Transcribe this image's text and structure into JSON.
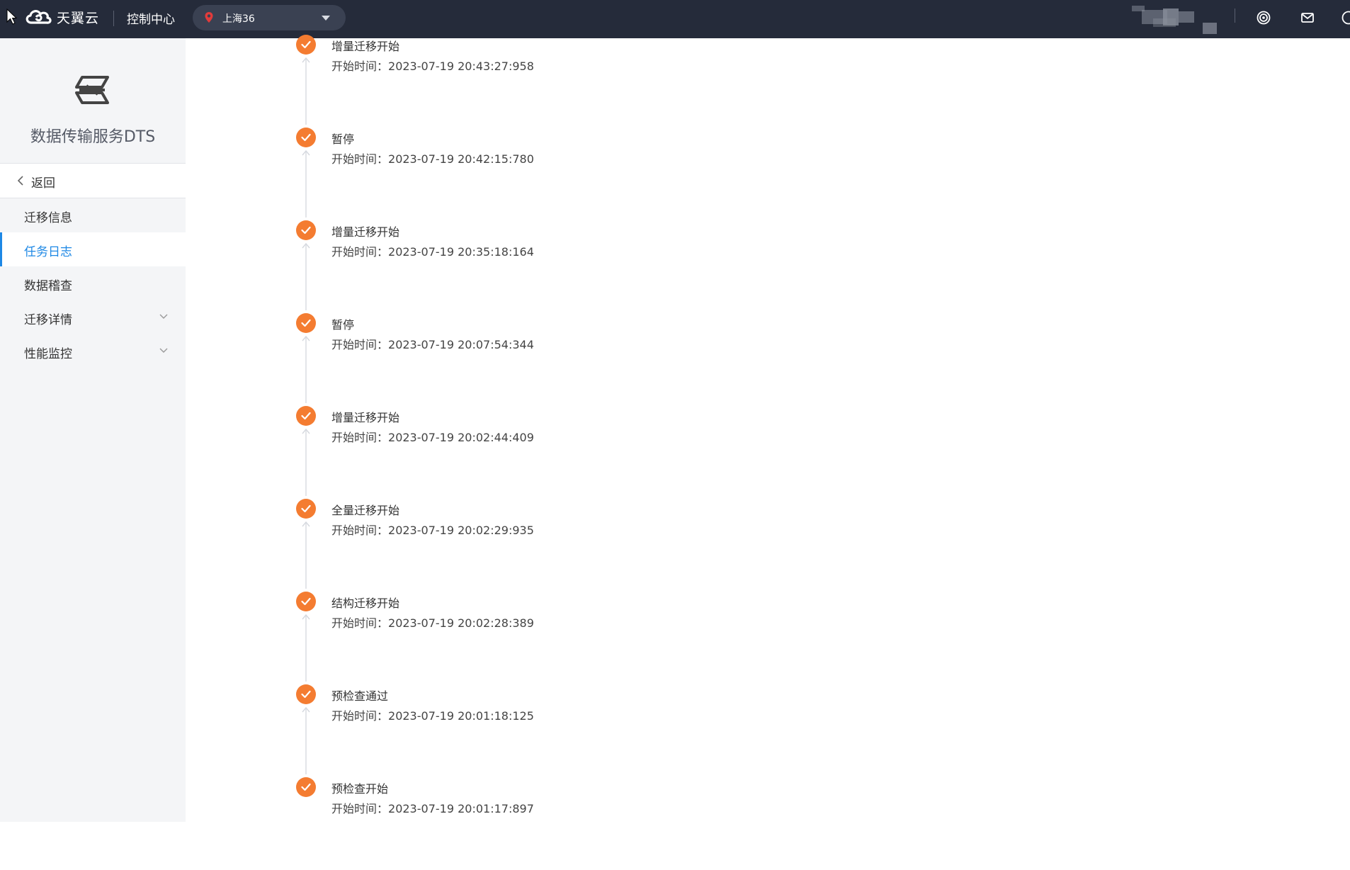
{
  "brand": {
    "logo_text": "天翼云",
    "console_label": "控制中心",
    "region_label": "上海36"
  },
  "colors": {
    "topbar": "#252b3a",
    "accent_blue": "#1e88e5",
    "timeline_orange": "#f47c31",
    "sidebar_bg": "#f4f5f7"
  },
  "sidebar": {
    "service_name": "数据传输服务DTS",
    "back_label": "返回",
    "items": [
      {
        "label": "迁移信息",
        "active": false,
        "expandable": false
      },
      {
        "label": "任务日志",
        "active": true,
        "expandable": false
      },
      {
        "label": "数据稽查",
        "active": false,
        "expandable": false
      },
      {
        "label": "迁移详情",
        "active": false,
        "expandable": true
      },
      {
        "label": "性能监控",
        "active": false,
        "expandable": true
      }
    ]
  },
  "timeline": {
    "time_prefix": "开始时间：",
    "events": [
      {
        "title": "增量迁移开始",
        "time": "2023-07-19 20:43:27:958"
      },
      {
        "title": "暂停",
        "time": "2023-07-19 20:42:15:780"
      },
      {
        "title": "增量迁移开始",
        "time": "2023-07-19 20:35:18:164"
      },
      {
        "title": "暂停",
        "time": "2023-07-19 20:07:54:344"
      },
      {
        "title": "增量迁移开始",
        "time": "2023-07-19 20:02:44:409"
      },
      {
        "title": "全量迁移开始",
        "time": "2023-07-19 20:02:29:935"
      },
      {
        "title": "结构迁移开始",
        "time": "2023-07-19 20:02:28:389"
      },
      {
        "title": "预检查通过",
        "time": "2023-07-19 20:01:18:125"
      },
      {
        "title": "预检查开始",
        "time": "2023-07-19 20:01:17:897"
      }
    ]
  },
  "icons": {
    "topbar": [
      "target-icon",
      "mail-icon",
      "help-icon"
    ]
  }
}
